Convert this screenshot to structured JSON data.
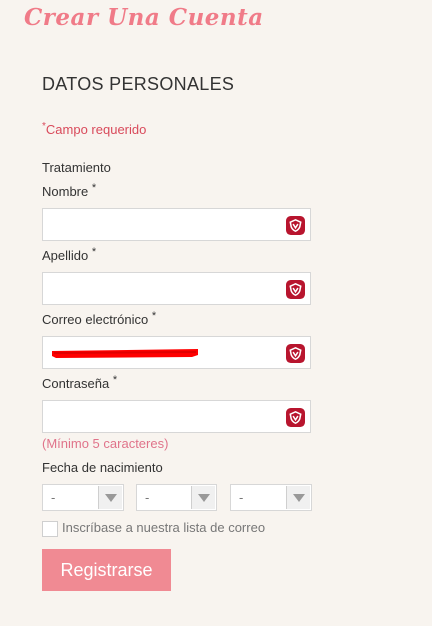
{
  "page": {
    "title": "Crear Una Cuenta"
  },
  "section": {
    "title": "DATOS PERSONALES"
  },
  "required_note": {
    "star": "*",
    "text": "Campo requerido"
  },
  "form": {
    "tratamiento_label": "Tratamiento",
    "nombre": {
      "label": "Nombre",
      "star": "*",
      "value": "",
      "icon": "shield-icon"
    },
    "apellido": {
      "label": "Apellido",
      "star": "*",
      "value": "",
      "icon": "shield-icon"
    },
    "correo": {
      "label": "Correo electrónico",
      "star": "*",
      "value": "[redacted]",
      "icon": "shield-icon"
    },
    "contrasena": {
      "label": "Contraseña",
      "star": "*",
      "value": "",
      "icon": "shield-icon",
      "hint": "(Mínimo 5 caracteres)"
    },
    "fecha": {
      "label": "Fecha de nacimiento",
      "day": "-",
      "month": "-",
      "year": "-"
    },
    "newsletter_label": "Inscríbase a nuestra lista de correo",
    "newsletter_checked": false,
    "submit_label": "Registrarse"
  },
  "colors": {
    "accent": "#f07b88",
    "required": "#d94a5b",
    "button": "#f08a93",
    "shield": "#b8152e",
    "redaction": "#ff0000",
    "background": "#f8f4ef"
  }
}
